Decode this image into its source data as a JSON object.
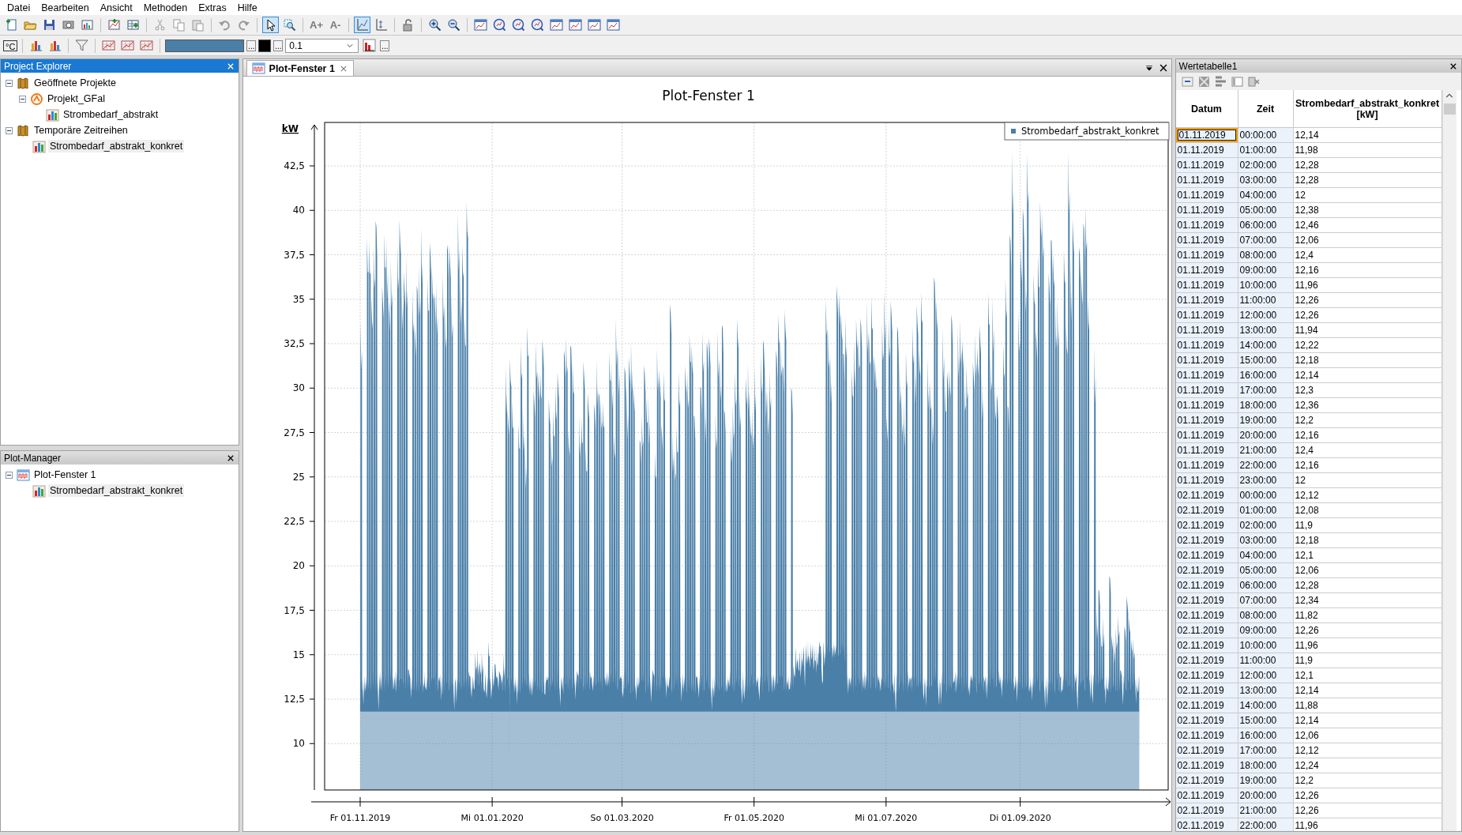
{
  "menu": [
    "Datei",
    "Bearbeiten",
    "Ansicht",
    "Methoden",
    "Extras",
    "Hilfe"
  ],
  "toolbar_1": [
    {
      "kind": "new"
    },
    {
      "kind": "open"
    },
    {
      "kind": "save"
    },
    {
      "kind": "print"
    },
    {
      "kind": "export"
    },
    {
      "kind": "sep"
    },
    {
      "kind": "chart-add"
    },
    {
      "kind": "table-add"
    },
    {
      "kind": "sep"
    },
    {
      "kind": "cut"
    },
    {
      "kind": "copy"
    },
    {
      "kind": "paste"
    },
    {
      "kind": "sep"
    },
    {
      "kind": "undo"
    },
    {
      "kind": "redo"
    },
    {
      "kind": "sep"
    },
    {
      "kind": "pointer",
      "pressed": true
    },
    {
      "kind": "zoom-rect",
      "pressed": false
    },
    {
      "kind": "sep"
    },
    {
      "kind": "text",
      "label": "A+"
    },
    {
      "kind": "text",
      "label": "A-"
    },
    {
      "kind": "sep"
    },
    {
      "kind": "axis-chart",
      "pressed": true
    },
    {
      "kind": "axis-chart-2",
      "pressed": false
    },
    {
      "kind": "sep"
    },
    {
      "kind": "lock"
    },
    {
      "kind": "sep"
    },
    {
      "kind": "zoom-in"
    },
    {
      "kind": "zoom-out"
    },
    {
      "kind": "sep"
    },
    {
      "kind": "chart-window"
    },
    {
      "kind": "magnifier"
    },
    {
      "kind": "magnifier"
    },
    {
      "kind": "magnifier"
    },
    {
      "kind": "chart-window"
    },
    {
      "kind": "chart-window"
    },
    {
      "kind": "chart-window"
    },
    {
      "kind": "chart-window"
    }
  ],
  "toolbar_2": [
    {
      "kind": "text",
      "label": "°C"
    },
    {
      "kind": "sep"
    },
    {
      "kind": "bar-chart"
    },
    {
      "kind": "bar-chart"
    },
    {
      "kind": "sep"
    },
    {
      "kind": "filter"
    },
    {
      "kind": "sep"
    },
    {
      "kind": "grid-chart"
    },
    {
      "kind": "grid-chart"
    },
    {
      "kind": "grid-chart"
    },
    {
      "kind": "sep"
    },
    {
      "kind": "color",
      "color": "#4a7fa8"
    },
    {
      "kind": "more",
      "label": "..."
    },
    {
      "kind": "color",
      "color": "#000000"
    },
    {
      "kind": "more",
      "label": "..."
    },
    {
      "kind": "select",
      "value": "0.1"
    },
    {
      "kind": "histogram"
    },
    {
      "kind": "more",
      "label": "..."
    }
  ],
  "project_explorer": {
    "title": "Project Explorer",
    "active": true,
    "tree": [
      {
        "label": "Geöffnete Projekte",
        "kind": "book",
        "expanded": true,
        "selected": false,
        "children": [
          {
            "label": "Projekt_GFal",
            "kind": "project",
            "expanded": true,
            "selected": false,
            "children": [
              {
                "label": "Strombedarf_abstrakt",
                "kind": "series",
                "selected": false
              }
            ]
          }
        ]
      },
      {
        "label": "Temporäre Zeitreihen",
        "kind": "book",
        "expanded": true,
        "selected": false,
        "children": [
          {
            "label": "Strombedarf_abstrakt_konkret",
            "kind": "series",
            "selected": true
          }
        ]
      }
    ]
  },
  "plot_manager": {
    "title": "Plot-Manager",
    "active": false,
    "tree": [
      {
        "label": "Plot-Fenster 1",
        "kind": "plot",
        "expanded": true,
        "selected": false,
        "children": [
          {
            "label": "Strombedarf_abstrakt_konkret",
            "kind": "series",
            "selected": true
          }
        ]
      }
    ]
  },
  "plot_window": {
    "tabs": [
      {
        "label": "Plot-Fenster 1",
        "selected": true
      }
    ],
    "title": "Plot-Fenster 1",
    "y_unit": "kW",
    "y_tick_labels": [
      "42,5",
      "40",
      "37,5",
      "35",
      "32,5",
      "30",
      "27,5",
      "25",
      "22,5",
      "20",
      "17,5",
      "15",
      "12,5",
      "10"
    ],
    "x_tick_labels": [
      "Fr 01.11.2019",
      "Mi 01.01.2020",
      "So 01.03.2020",
      "Fr 01.05.2020",
      "Mi 01.07.2020",
      "Di 01.09.2020"
    ],
    "legend": "Strombedarf_abstrakt_konkret"
  },
  "value_table": {
    "title": "Wertetabelle1",
    "columns": [
      "Datum",
      "Zeit",
      "Strombedarf_abstrakt_konkret [kW]"
    ],
    "rows": [
      {
        "datum": "01.11.2019",
        "zeit": "00:00:00",
        "value": "12,14",
        "highlighted": true
      },
      {
        "datum": "01.11.2019",
        "zeit": "01:00:00",
        "value": "11,98",
        "highlighted": false
      },
      {
        "datum": "01.11.2019",
        "zeit": "02:00:00",
        "value": "12,28",
        "highlighted": false
      },
      {
        "datum": "01.11.2019",
        "zeit": "03:00:00",
        "value": "12,28",
        "highlighted": false
      },
      {
        "datum": "01.11.2019",
        "zeit": "04:00:00",
        "value": "12",
        "highlighted": false
      },
      {
        "datum": "01.11.2019",
        "zeit": "05:00:00",
        "value": "12,38",
        "highlighted": false
      },
      {
        "datum": "01.11.2019",
        "zeit": "06:00:00",
        "value": "12,46",
        "highlighted": false
      },
      {
        "datum": "01.11.2019",
        "zeit": "07:00:00",
        "value": "12,06",
        "highlighted": false
      },
      {
        "datum": "01.11.2019",
        "zeit": "08:00:00",
        "value": "12,4",
        "highlighted": false
      },
      {
        "datum": "01.11.2019",
        "zeit": "09:00:00",
        "value": "12,16",
        "highlighted": false
      },
      {
        "datum": "01.11.2019",
        "zeit": "10:00:00",
        "value": "11,96",
        "highlighted": false
      },
      {
        "datum": "01.11.2019",
        "zeit": "11:00:00",
        "value": "12,26",
        "highlighted": false
      },
      {
        "datum": "01.11.2019",
        "zeit": "12:00:00",
        "value": "12,26",
        "highlighted": false
      },
      {
        "datum": "01.11.2019",
        "zeit": "13:00:00",
        "value": "11,94",
        "highlighted": false
      },
      {
        "datum": "01.11.2019",
        "zeit": "14:00:00",
        "value": "12,22",
        "highlighted": false
      },
      {
        "datum": "01.11.2019",
        "zeit": "15:00:00",
        "value": "12,18",
        "highlighted": false
      },
      {
        "datum": "01.11.2019",
        "zeit": "16:00:00",
        "value": "12,14",
        "highlighted": false
      },
      {
        "datum": "01.11.2019",
        "zeit": "17:00:00",
        "value": "12,3",
        "highlighted": false
      },
      {
        "datum": "01.11.2019",
        "zeit": "18:00:00",
        "value": "12,36",
        "highlighted": false
      },
      {
        "datum": "01.11.2019",
        "zeit": "19:00:00",
        "value": "12,2",
        "highlighted": false
      },
      {
        "datum": "01.11.2019",
        "zeit": "20:00:00",
        "value": "12,16",
        "highlighted": false
      },
      {
        "datum": "01.11.2019",
        "zeit": "21:00:00",
        "value": "12,4",
        "highlighted": false
      },
      {
        "datum": "01.11.2019",
        "zeit": "22:00:00",
        "value": "12,16",
        "highlighted": false
      },
      {
        "datum": "01.11.2019",
        "zeit": "23:00:00",
        "value": "12",
        "highlighted": false
      },
      {
        "datum": "02.11.2019",
        "zeit": "00:00:00",
        "value": "12,12",
        "highlighted": false
      },
      {
        "datum": "02.11.2019",
        "zeit": "01:00:00",
        "value": "12,08",
        "highlighted": false
      },
      {
        "datum": "02.11.2019",
        "zeit": "02:00:00",
        "value": "11,9",
        "highlighted": false
      },
      {
        "datum": "02.11.2019",
        "zeit": "03:00:00",
        "value": "12,18",
        "highlighted": false
      },
      {
        "datum": "02.11.2019",
        "zeit": "04:00:00",
        "value": "12,1",
        "highlighted": false
      },
      {
        "datum": "02.11.2019",
        "zeit": "05:00:00",
        "value": "12,06",
        "highlighted": false
      },
      {
        "datum": "02.11.2019",
        "zeit": "06:00:00",
        "value": "12,28",
        "highlighted": false
      },
      {
        "datum": "02.11.2019",
        "zeit": "07:00:00",
        "value": "12,34",
        "highlighted": false
      },
      {
        "datum": "02.11.2019",
        "zeit": "08:00:00",
        "value": "11,82",
        "highlighted": false
      },
      {
        "datum": "02.11.2019",
        "zeit": "09:00:00",
        "value": "12,26",
        "highlighted": false
      },
      {
        "datum": "02.11.2019",
        "zeit": "10:00:00",
        "value": "11,96",
        "highlighted": false
      },
      {
        "datum": "02.11.2019",
        "zeit": "11:00:00",
        "value": "11,9",
        "highlighted": false
      },
      {
        "datum": "02.11.2019",
        "zeit": "12:00:00",
        "value": "12,1",
        "highlighted": false
      },
      {
        "datum": "02.11.2019",
        "zeit": "13:00:00",
        "value": "12,14",
        "highlighted": false
      },
      {
        "datum": "02.11.2019",
        "zeit": "14:00:00",
        "value": "11,88",
        "highlighted": false
      },
      {
        "datum": "02.11.2019",
        "zeit": "15:00:00",
        "value": "12,14",
        "highlighted": false
      },
      {
        "datum": "02.11.2019",
        "zeit": "16:00:00",
        "value": "12,06",
        "highlighted": false
      },
      {
        "datum": "02.11.2019",
        "zeit": "17:00:00",
        "value": "12,12",
        "highlighted": false
      },
      {
        "datum": "02.11.2019",
        "zeit": "18:00:00",
        "value": "12,24",
        "highlighted": false
      },
      {
        "datum": "02.11.2019",
        "zeit": "19:00:00",
        "value": "12,2",
        "highlighted": false
      },
      {
        "datum": "02.11.2019",
        "zeit": "20:00:00",
        "value": "12,26",
        "highlighted": false
      },
      {
        "datum": "02.11.2019",
        "zeit": "21:00:00",
        "value": "12,26",
        "highlighted": false
      },
      {
        "datum": "02.11.2019",
        "zeit": "22:00:00",
        "value": "11,96",
        "highlighted": false
      }
    ]
  }
}
